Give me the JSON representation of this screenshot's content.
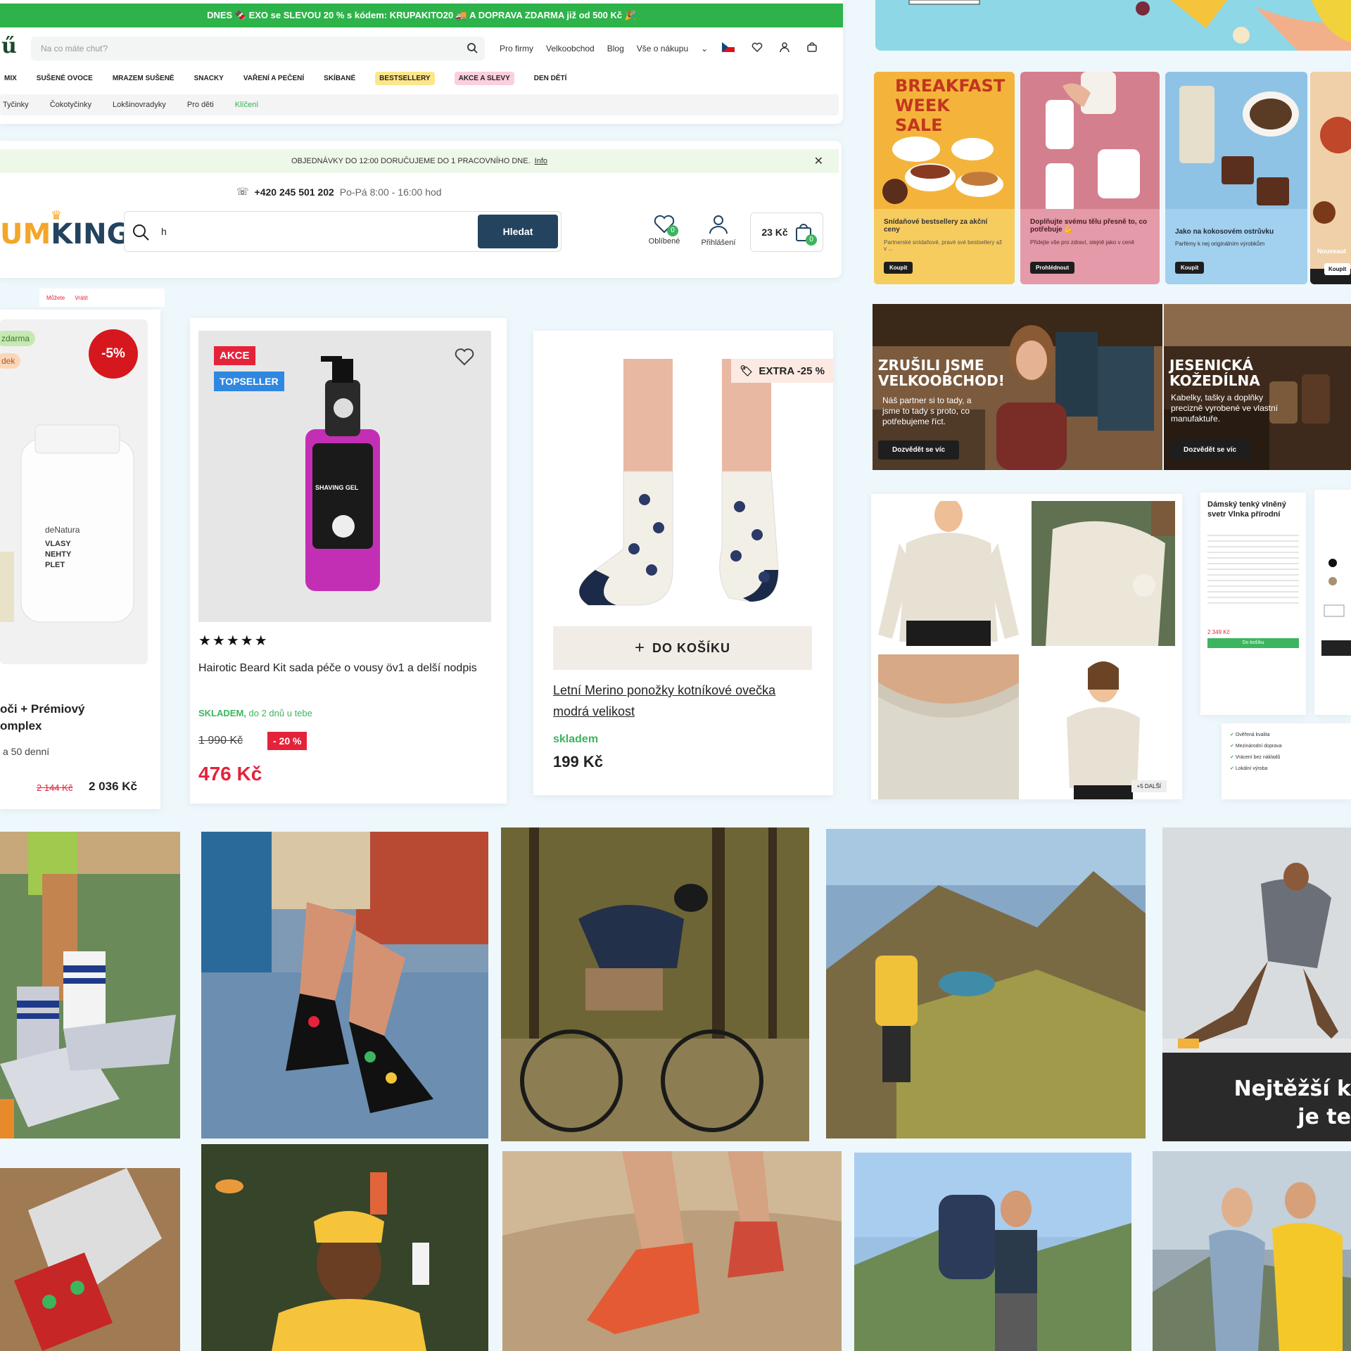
{
  "colors": {
    "promo_green": "#2db34a",
    "king_blue": "#23435f",
    "sale_red": "#e4233a",
    "stock_green": "#3cb55e",
    "page_bg": "#eef7fc"
  },
  "shop1": {
    "promo_bar": "DNES 🍫 EXO se SLEVOU 20 % s kódem: KRUPAKITO20 🚚 A DOPRAVA ZDARMA již od 500 Kč 🎉",
    "logo_glyph": "ű",
    "search_placeholder": "Na co máte chuť?",
    "top_links": [
      "Pro firmy",
      "Velkoobchod",
      "Blog",
      "Vše o nákupu"
    ],
    "nav": [
      "MIX",
      "SUŠENÉ OVOCE",
      "MRAZEM SUŠENÉ",
      "SNACKY",
      "VAŘENÍ A PEČENÍ",
      "SKÍBANÉ",
      "BESTSELLERY",
      "AKCE A SLEVY",
      "DEN DĚTÍ"
    ],
    "subnav": [
      "Tyčinky",
      "Čokotyčinky",
      "Lokšinovradyky",
      "Pro děti",
      "Klíčení"
    ]
  },
  "shop2": {
    "notice": "OBJEDNÁVKY DO 12:00 DORUČUJEME DO 1 PRACOVNÍHO DNE.",
    "notice_link": "Info",
    "phone": "+420 245 501 202",
    "hours": "Po-Pá 8:00 - 16:00 hod",
    "logo_part1": "UM",
    "logo_part2": "KING",
    "search_value": "h",
    "search_button": "Hledat",
    "favorites_label": "Oblíbené",
    "favorites_count": "0",
    "login_label": "Přihlášení",
    "cart_price": "23 Kč",
    "cart_count": "0"
  },
  "product1": {
    "badge_free": "zdarma",
    "badge_other": "dek",
    "discount": "-5%",
    "bottle_brand": "deNatura",
    "bottle_lines": [
      "VLASY",
      "NEHTY",
      "PLET"
    ],
    "title_line1": "oči + Prémiový",
    "title_line2": "omplex",
    "subtitle": "a 50 denní",
    "old_price": "2 144 Kč",
    "price": "2 036 Kč",
    "top_tab1": "Můžete",
    "top_tab2": "Vrátit"
  },
  "product2": {
    "badge_sale": "AKCE",
    "badge_top": "TOPSELLER",
    "bottle_label": "SHAVING GEL",
    "stars": "★★★★★",
    "title": "Hairotic Beard Kit sada péče o vousy öv1 a delší nodpis",
    "stock": "SKLADEM,",
    "stock_note": "do 2 dnů u tebe",
    "old_price": "1 990 Kč",
    "discount": "- 20 %",
    "price": "476 Kč"
  },
  "product3": {
    "badge": "EXTRA -25 %",
    "cart_button": "DO KOŠÍKU",
    "title": "Letní Merino ponožky kotníkové ovečka modrá velikost",
    "stock": "skladem",
    "price": "199 Kč"
  },
  "banners": [
    {
      "title": "BREAKFAST WEEK SALE",
      "text": "Snídaňové bestsellery za akční ceny",
      "sub": "Partnerské snídaňové, pravé své bestsellery až v ...",
      "button": "Koupit"
    },
    {
      "title": "",
      "text": "Doplňujte svému tělu přesně to, co potřebuje 💪",
      "sub": "Přidejte vše pro zdraví, stejně jako v ceně",
      "button": "Prohlédnout"
    },
    {
      "title": "",
      "text": "Jako na kokosovém ostrůvku",
      "sub": "Parfémy k nej originálním výrobkům",
      "button": "Koupit"
    },
    {
      "title": "",
      "text": "Nouveaut",
      "sub": "",
      "button": "Koupit"
    }
  ],
  "store_banners": [
    {
      "title": "ZRUŠILI JSME VELKOOBCHOD!",
      "text": "Náš partner si to tady, a jsme to tady s proto, co potřebujeme říct.",
      "button": "Dozvědět se víc"
    },
    {
      "title": "JESENICKÁ KOŽEDÍLNA",
      "text": "Kabelky, tašky a doplňky precizně vyrobené ve vlastní manufaktuře.",
      "button": "Dozvědět se víc"
    }
  ],
  "sweater": {
    "more_badge": "+5 DALŠÍ",
    "detail_title": "Dámský tenký vlněný svetr Vlnka přírodní",
    "detail_price": "2 349 Kč",
    "detail_button": "Do košíku",
    "features": [
      "Ověřená kvalita",
      "Mezinárodní doprava",
      "Vrácení bez nákladů",
      "Lokální výroba"
    ]
  },
  "photo_overlay": {
    "line1": "Nejtěžší k",
    "line2": "je te"
  }
}
